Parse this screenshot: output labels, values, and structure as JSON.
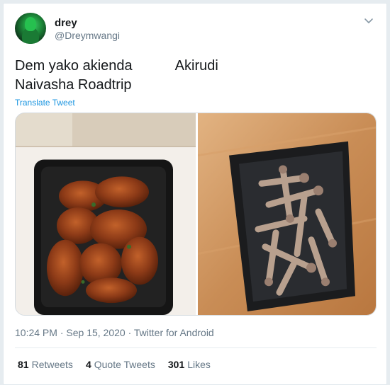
{
  "tweet": {
    "author_name": "drey",
    "author_handle": "@Dreymwangi",
    "text": "Dem yako akienda           Akirudi\nNaivasha Roadtrip",
    "translate_label": "Translate Tweet",
    "icons": {
      "avatar": "profile-avatar",
      "menu": "chevron-down-icon"
    },
    "media": [
      {
        "description_name": "wings-full-photo"
      },
      {
        "description_name": "bones-empty-photo"
      }
    ],
    "meta": {
      "time": "10:24 PM",
      "separator1": " · ",
      "date": "Sep 15, 2020",
      "separator2": " · ",
      "source": "Twitter for Android"
    },
    "stats": {
      "retweets_count": "81",
      "retweets_label": "Retweets",
      "quotes_count": "4",
      "quotes_label": "Quote Tweets",
      "likes_count": "301",
      "likes_label": "Likes"
    }
  },
  "colors": {
    "link": "#1b95e0",
    "secondary_text": "#657786",
    "border": "#e6ecf0"
  }
}
